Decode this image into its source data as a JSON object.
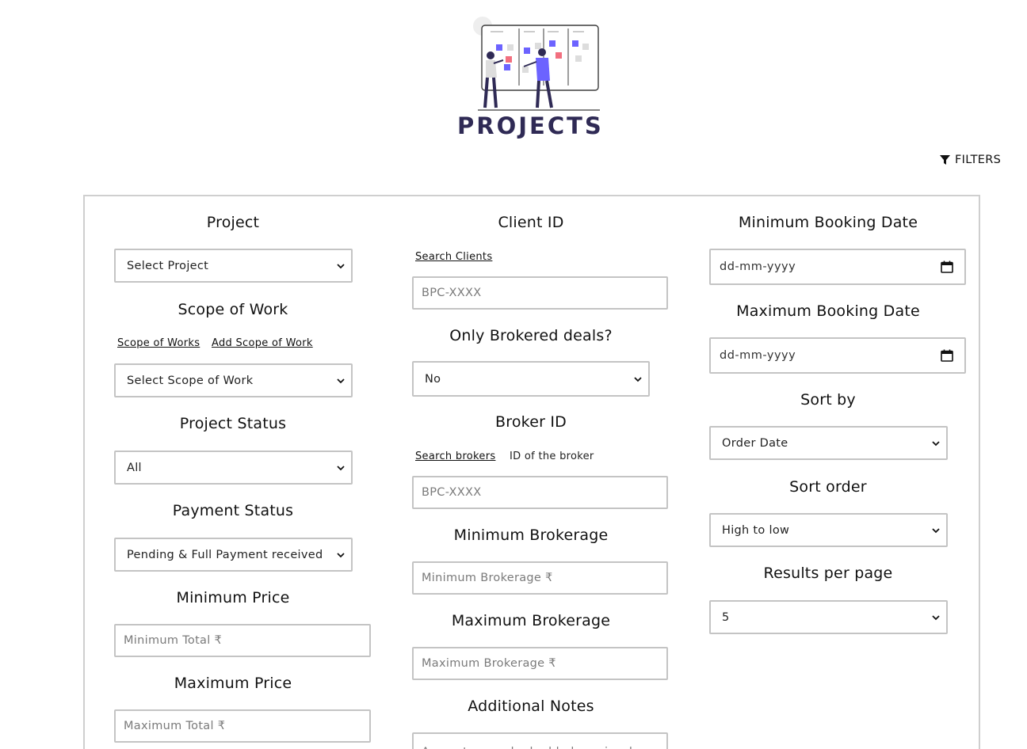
{
  "header": {
    "title": "PROJECTS",
    "illustration": "team-kanban-illustration",
    "filters_label": "FILTERS"
  },
  "left_column": {
    "project": {
      "label": "Project",
      "value": "Select Project"
    },
    "scope": {
      "label": "Scope of Work",
      "links": [
        "Scope of Works",
        "Add Scope of Work"
      ],
      "value": "Select Scope of Work"
    },
    "project_status": {
      "label": "Project Status",
      "value": "All"
    },
    "payment_status": {
      "label": "Payment Status",
      "value": "Pending & Full Payment received"
    },
    "min_price": {
      "label": "Minimum Price",
      "placeholder": "Minimum Total ₹"
    },
    "max_price": {
      "label": "Maximum Price",
      "placeholder": "Maximum Total ₹"
    }
  },
  "middle_column": {
    "client_id": {
      "label": "Client ID",
      "link": "Search Clients",
      "placeholder": "BPC-XXXX"
    },
    "brokered": {
      "label": "Only Brokered deals?",
      "value": "No"
    },
    "broker_id": {
      "label": "Broker ID",
      "link": "Search brokers",
      "hint": "ID of the broker",
      "placeholder": "BPC-XXXX"
    },
    "min_brokerage": {
      "label": "Minimum Brokerage",
      "placeholder": "Minimum Brokerage ₹"
    },
    "max_brokerage": {
      "label": "Maximum Brokerage",
      "placeholder": "Maximum Brokerage ₹"
    },
    "notes": {
      "label": "Additional Notes",
      "placeholder": "Any notes you had added previously"
    }
  },
  "right_column": {
    "min_booking": {
      "label": "Minimum Booking Date",
      "value": "dd-mm-yyyy"
    },
    "max_booking": {
      "label": "Maximum Booking Date",
      "value": "dd-mm-yyyy"
    },
    "sort_by": {
      "label": "Sort by",
      "value": "Order Date"
    },
    "sort_order": {
      "label": "Sort order",
      "value": "High to low"
    },
    "per_page": {
      "label": "Results per page",
      "value": "5"
    }
  },
  "colors": {
    "title": "#2f2a55",
    "accent_purple": "#6c63ff",
    "accent_pink": "#f26f7f",
    "border": "#c4c4c4"
  }
}
